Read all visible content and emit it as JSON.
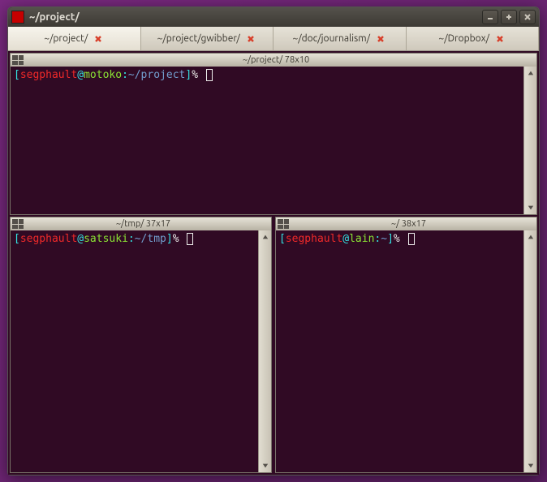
{
  "titlebar": {
    "title": "~/project/"
  },
  "tabs": [
    {
      "label": "~/project/"
    },
    {
      "label": "~/project/gwibber/"
    },
    {
      "label": "~/doc/journalism/"
    },
    {
      "label": "~/Dropbox/"
    }
  ],
  "panes": {
    "top": {
      "header": "~/project/ 78x10",
      "prompt": {
        "user": "segphault",
        "host": "motoko",
        "path": "~/project",
        "symbol": "%"
      }
    },
    "left": {
      "header": "~/tmp/ 37x17",
      "prompt": {
        "user": "segphault",
        "host": "satsuki",
        "path": "~/tmp",
        "symbol": "%"
      }
    },
    "right": {
      "header": "~/ 38x17",
      "prompt": {
        "user": "segphault",
        "host": "lain",
        "path": "~",
        "symbol": "%"
      }
    }
  }
}
